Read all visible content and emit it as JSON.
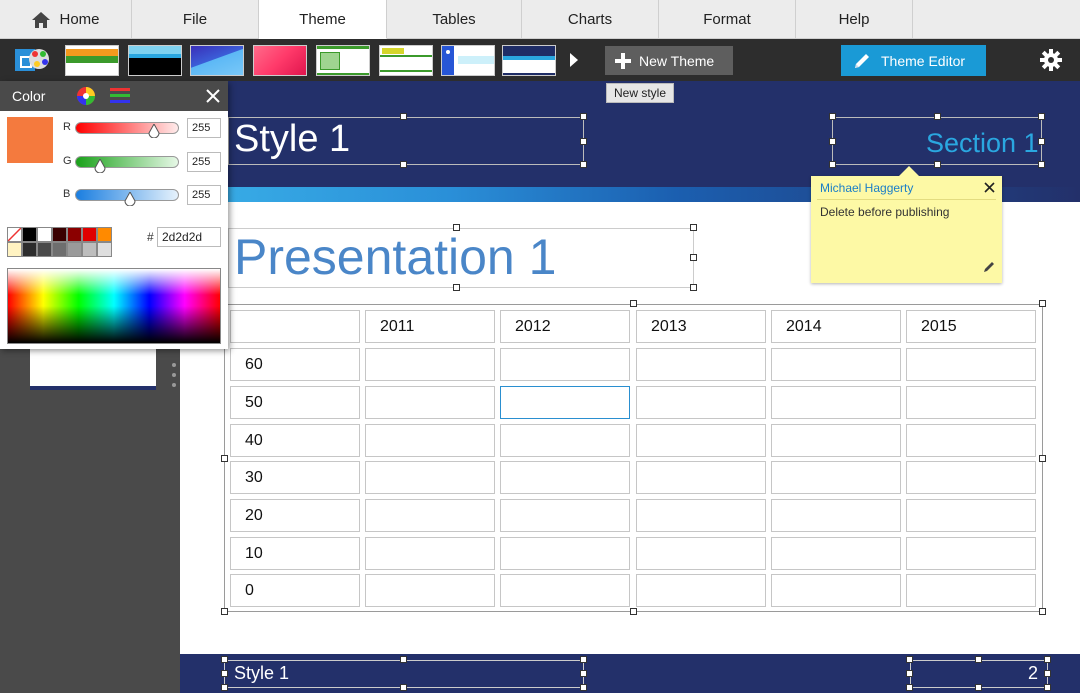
{
  "menu": {
    "tabs": [
      {
        "label": "Home"
      },
      {
        "label": "File"
      },
      {
        "label": "Theme"
      },
      {
        "label": "Tables"
      },
      {
        "label": "Charts"
      },
      {
        "label": "Format"
      },
      {
        "label": "Help"
      }
    ],
    "active": "Theme"
  },
  "toolbar": {
    "new_theme_label": "New Theme",
    "tooltip": "New style",
    "theme_editor_label": "Theme Editor"
  },
  "color_panel": {
    "title": "Color",
    "r_label": "R",
    "g_label": "G",
    "b_label": "B",
    "r_value": "255",
    "g_value": "255",
    "b_value": "255",
    "hash": "#",
    "hex": "2d2d2d",
    "preview_color": "#f47a3e"
  },
  "slide": {
    "style_title": "Style 1",
    "section_title": "Section 1",
    "presentation_title": "Presentation 1",
    "footer_style": "Style 1",
    "page_number": "2"
  },
  "table": {
    "header": [
      "",
      "2011",
      "2012",
      "2013",
      "2014",
      "2015"
    ],
    "rows": [
      "60",
      "50",
      "40",
      "30",
      "20",
      "10",
      "0"
    ]
  },
  "comment": {
    "author": "Michael Haggerty",
    "text": "Delete before publishing"
  },
  "colors": {
    "header_navy": "#23306a",
    "accent_blue": "#1a9ad6",
    "title_blue": "#4a86c8",
    "section_blue": "#2aa7e0",
    "comment_yellow": "#fdf9a5"
  }
}
